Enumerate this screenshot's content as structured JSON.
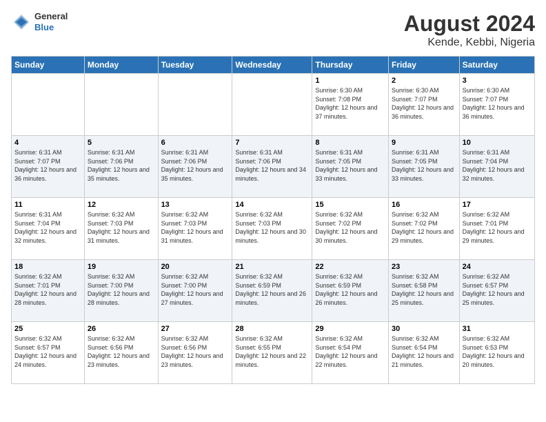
{
  "logo": {
    "line1": "General",
    "line2": "Blue"
  },
  "title": "August 2024",
  "subtitle": "Kende, Kebbi, Nigeria",
  "headers": [
    "Sunday",
    "Monday",
    "Tuesday",
    "Wednesday",
    "Thursday",
    "Friday",
    "Saturday"
  ],
  "weeks": [
    [
      {
        "day": "",
        "sunrise": "",
        "sunset": "",
        "daylight": ""
      },
      {
        "day": "",
        "sunrise": "",
        "sunset": "",
        "daylight": ""
      },
      {
        "day": "",
        "sunrise": "",
        "sunset": "",
        "daylight": ""
      },
      {
        "day": "",
        "sunrise": "",
        "sunset": "",
        "daylight": ""
      },
      {
        "day": "1",
        "sunrise": "Sunrise: 6:30 AM",
        "sunset": "Sunset: 7:08 PM",
        "daylight": "Daylight: 12 hours and 37 minutes."
      },
      {
        "day": "2",
        "sunrise": "Sunrise: 6:30 AM",
        "sunset": "Sunset: 7:07 PM",
        "daylight": "Daylight: 12 hours and 36 minutes."
      },
      {
        "day": "3",
        "sunrise": "Sunrise: 6:30 AM",
        "sunset": "Sunset: 7:07 PM",
        "daylight": "Daylight: 12 hours and 36 minutes."
      }
    ],
    [
      {
        "day": "4",
        "sunrise": "Sunrise: 6:31 AM",
        "sunset": "Sunset: 7:07 PM",
        "daylight": "Daylight: 12 hours and 36 minutes."
      },
      {
        "day": "5",
        "sunrise": "Sunrise: 6:31 AM",
        "sunset": "Sunset: 7:06 PM",
        "daylight": "Daylight: 12 hours and 35 minutes."
      },
      {
        "day": "6",
        "sunrise": "Sunrise: 6:31 AM",
        "sunset": "Sunset: 7:06 PM",
        "daylight": "Daylight: 12 hours and 35 minutes."
      },
      {
        "day": "7",
        "sunrise": "Sunrise: 6:31 AM",
        "sunset": "Sunset: 7:06 PM",
        "daylight": "Daylight: 12 hours and 34 minutes."
      },
      {
        "day": "8",
        "sunrise": "Sunrise: 6:31 AM",
        "sunset": "Sunset: 7:05 PM",
        "daylight": "Daylight: 12 hours and 33 minutes."
      },
      {
        "day": "9",
        "sunrise": "Sunrise: 6:31 AM",
        "sunset": "Sunset: 7:05 PM",
        "daylight": "Daylight: 12 hours and 33 minutes."
      },
      {
        "day": "10",
        "sunrise": "Sunrise: 6:31 AM",
        "sunset": "Sunset: 7:04 PM",
        "daylight": "Daylight: 12 hours and 32 minutes."
      }
    ],
    [
      {
        "day": "11",
        "sunrise": "Sunrise: 6:31 AM",
        "sunset": "Sunset: 7:04 PM",
        "daylight": "Daylight: 12 hours and 32 minutes."
      },
      {
        "day": "12",
        "sunrise": "Sunrise: 6:32 AM",
        "sunset": "Sunset: 7:03 PM",
        "daylight": "Daylight: 12 hours and 31 minutes."
      },
      {
        "day": "13",
        "sunrise": "Sunrise: 6:32 AM",
        "sunset": "Sunset: 7:03 PM",
        "daylight": "Daylight: 12 hours and 31 minutes."
      },
      {
        "day": "14",
        "sunrise": "Sunrise: 6:32 AM",
        "sunset": "Sunset: 7:03 PM",
        "daylight": "Daylight: 12 hours and 30 minutes."
      },
      {
        "day": "15",
        "sunrise": "Sunrise: 6:32 AM",
        "sunset": "Sunset: 7:02 PM",
        "daylight": "Daylight: 12 hours and 30 minutes."
      },
      {
        "day": "16",
        "sunrise": "Sunrise: 6:32 AM",
        "sunset": "Sunset: 7:02 PM",
        "daylight": "Daylight: 12 hours and 29 minutes."
      },
      {
        "day": "17",
        "sunrise": "Sunrise: 6:32 AM",
        "sunset": "Sunset: 7:01 PM",
        "daylight": "Daylight: 12 hours and 29 minutes."
      }
    ],
    [
      {
        "day": "18",
        "sunrise": "Sunrise: 6:32 AM",
        "sunset": "Sunset: 7:01 PM",
        "daylight": "Daylight: 12 hours and 28 minutes."
      },
      {
        "day": "19",
        "sunrise": "Sunrise: 6:32 AM",
        "sunset": "Sunset: 7:00 PM",
        "daylight": "Daylight: 12 hours and 28 minutes."
      },
      {
        "day": "20",
        "sunrise": "Sunrise: 6:32 AM",
        "sunset": "Sunset: 7:00 PM",
        "daylight": "Daylight: 12 hours and 27 minutes."
      },
      {
        "day": "21",
        "sunrise": "Sunrise: 6:32 AM",
        "sunset": "Sunset: 6:59 PM",
        "daylight": "Daylight: 12 hours and 26 minutes."
      },
      {
        "day": "22",
        "sunrise": "Sunrise: 6:32 AM",
        "sunset": "Sunset: 6:59 PM",
        "daylight": "Daylight: 12 hours and 26 minutes."
      },
      {
        "day": "23",
        "sunrise": "Sunrise: 6:32 AM",
        "sunset": "Sunset: 6:58 PM",
        "daylight": "Daylight: 12 hours and 25 minutes."
      },
      {
        "day": "24",
        "sunrise": "Sunrise: 6:32 AM",
        "sunset": "Sunset: 6:57 PM",
        "daylight": "Daylight: 12 hours and 25 minutes."
      }
    ],
    [
      {
        "day": "25",
        "sunrise": "Sunrise: 6:32 AM",
        "sunset": "Sunset: 6:57 PM",
        "daylight": "Daylight: 12 hours and 24 minutes."
      },
      {
        "day": "26",
        "sunrise": "Sunrise: 6:32 AM",
        "sunset": "Sunset: 6:56 PM",
        "daylight": "Daylight: 12 hours and 23 minutes."
      },
      {
        "day": "27",
        "sunrise": "Sunrise: 6:32 AM",
        "sunset": "Sunset: 6:56 PM",
        "daylight": "Daylight: 12 hours and 23 minutes."
      },
      {
        "day": "28",
        "sunrise": "Sunrise: 6:32 AM",
        "sunset": "Sunset: 6:55 PM",
        "daylight": "Daylight: 12 hours and 22 minutes."
      },
      {
        "day": "29",
        "sunrise": "Sunrise: 6:32 AM",
        "sunset": "Sunset: 6:54 PM",
        "daylight": "Daylight: 12 hours and 22 minutes."
      },
      {
        "day": "30",
        "sunrise": "Sunrise: 6:32 AM",
        "sunset": "Sunset: 6:54 PM",
        "daylight": "Daylight: 12 hours and 21 minutes."
      },
      {
        "day": "31",
        "sunrise": "Sunrise: 6:32 AM",
        "sunset": "Sunset: 6:53 PM",
        "daylight": "Daylight: 12 hours and 20 minutes."
      }
    ]
  ]
}
